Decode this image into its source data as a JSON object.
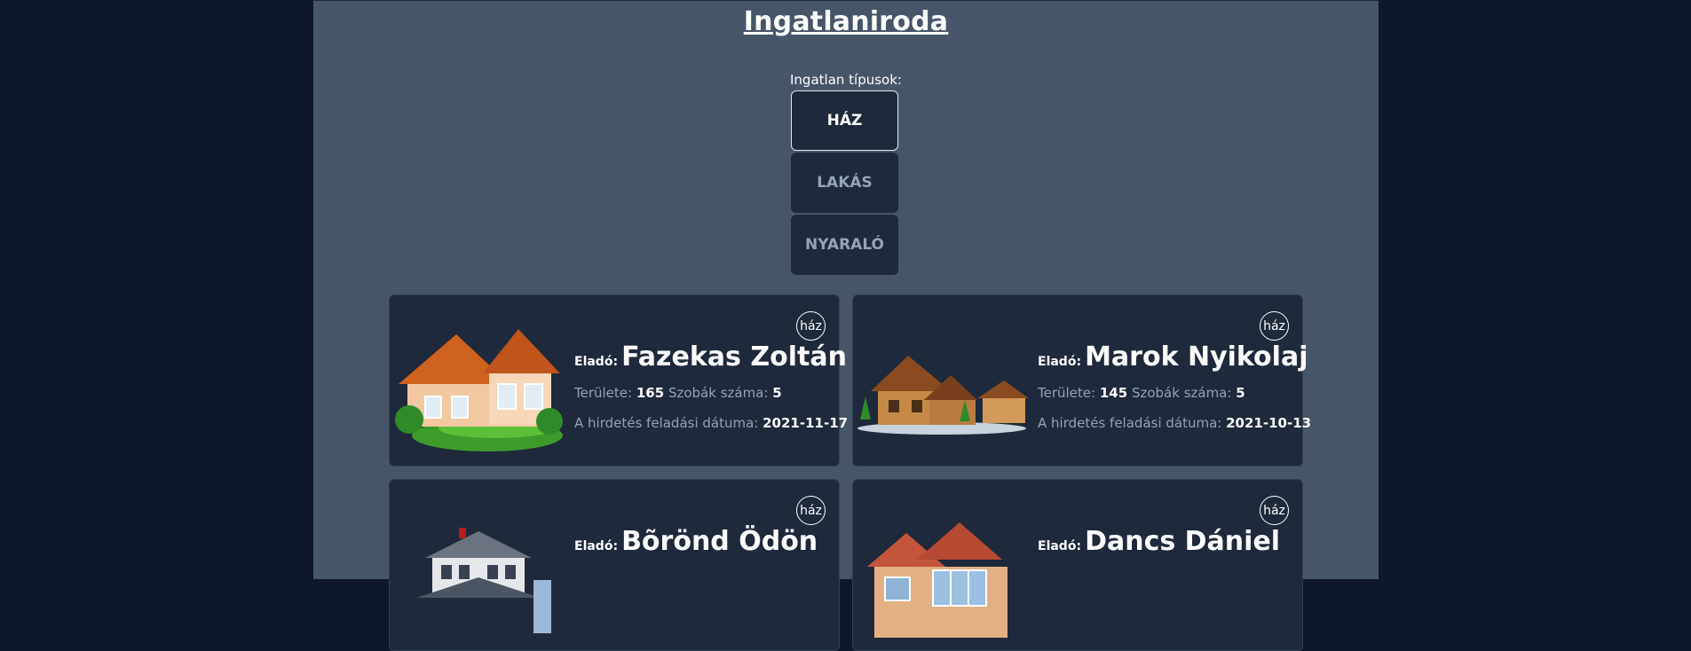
{
  "header": {
    "title": "Ingatlaniroda"
  },
  "types": {
    "label": "Ingatlan típusok:",
    "options": [
      "HÁZ",
      "LAKÁS",
      "NYARALÓ"
    ],
    "active": "HÁZ"
  },
  "labels": {
    "seller_prefix": "Eladó:",
    "area": "Területe:",
    "rooms": "Szobák száma:",
    "date": "A hirdetés feladási dátuma:"
  },
  "listings": [
    {
      "badge": "ház",
      "seller": "Fazekas Zoltán",
      "area": "165",
      "rooms": "5",
      "date": "2021-11-17",
      "image_icon": "house-photo-icon"
    },
    {
      "badge": "ház",
      "seller": "Marok Nyikolaj",
      "area": "145",
      "rooms": "5",
      "date": "2021-10-13",
      "image_icon": "wooden-house-photo-icon"
    },
    {
      "badge": "ház",
      "seller": "Bõrönd Ödön",
      "image_icon": "white-house-photo-icon"
    },
    {
      "badge": "ház",
      "seller": "Dancs Dániel",
      "image_icon": "brick-house-photo-icon"
    }
  ]
}
